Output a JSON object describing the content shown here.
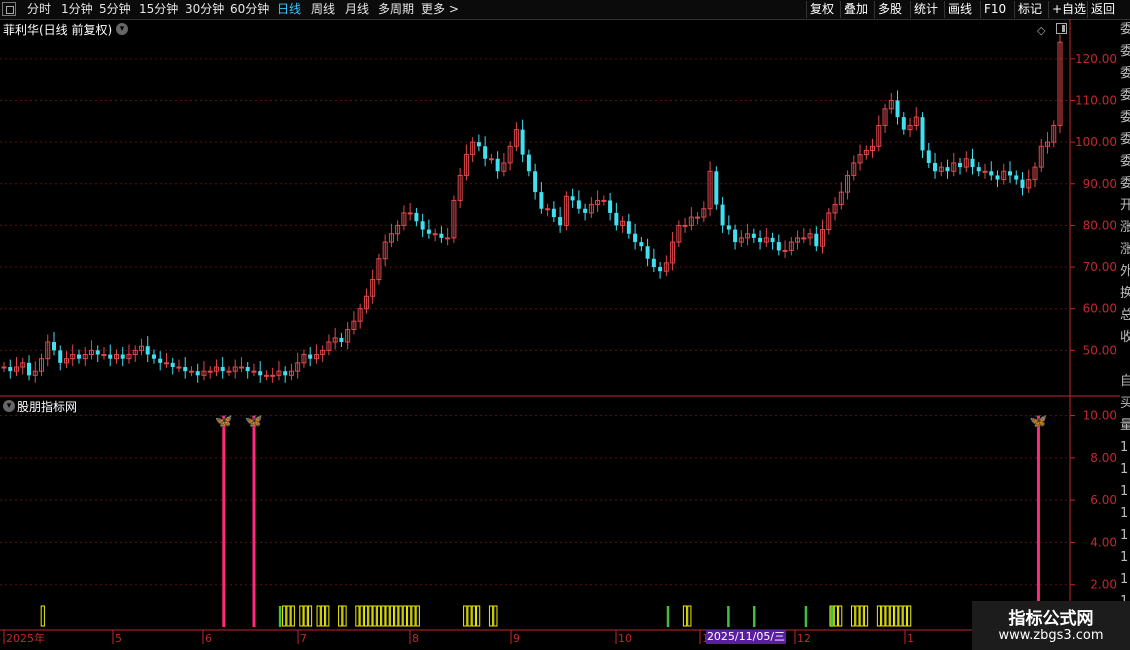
{
  "toolbar": {
    "left_items": [
      "分时",
      "1分钟",
      "5分钟",
      "15分钟",
      "30分钟",
      "60分钟",
      "日线",
      "周线",
      "月线",
      "多周期",
      "更多 >"
    ],
    "active_index": 6,
    "right_items": [
      "复权",
      "叠加",
      "多股",
      "统计",
      "画线",
      "F10",
      "标记",
      "+自选",
      "返回"
    ]
  },
  "stock_title": "菲利华(日线 前复权)",
  "indicator_title": "股朋指标网",
  "right_column_chars": [
    "委",
    "委",
    "委",
    "委",
    "委",
    "委",
    "委",
    "委",
    "开",
    "涨",
    "涨",
    "外",
    "换",
    "总",
    "收",
    "",
    "自",
    "买",
    "量",
    "1",
    "1",
    "1",
    "1",
    "1",
    "1",
    "1",
    "1"
  ],
  "watermark": {
    "title": "指标公式网",
    "url": "www.zbgs3.com"
  },
  "date_tag": "2025/11/05/三",
  "colors": {
    "up": "#e0484c",
    "down": "#40e0f0",
    "grid": "#5a1212",
    "axis": "#c0282c",
    "signal": "#ff2a7a",
    "box": "#f0f000",
    "bar_green": "#40c040"
  },
  "chart_data": [
    {
      "type": "candlestick",
      "title": "菲利华(日线 前复权)",
      "ylim": [
        40,
        125
      ],
      "y_ticks": [
        "120.00",
        "110.00",
        "100.00",
        "90.00",
        "80.00",
        "70.00",
        "60.00",
        "50.00"
      ],
      "x_labels": [
        "2025年",
        "5",
        "6",
        "7",
        "8",
        "9",
        "10",
        "11",
        "12",
        "1"
      ],
      "approx_close_series": [
        46,
        45,
        46,
        47,
        44,
        45,
        48,
        52,
        50,
        47,
        48,
        49,
        48,
        49,
        50,
        49,
        49,
        48,
        49,
        48,
        49,
        50,
        51,
        49,
        48,
        47,
        47,
        46,
        46,
        45,
        45,
        44,
        45,
        45,
        46,
        45,
        45,
        46,
        46,
        45,
        45,
        44,
        44,
        44,
        45,
        44,
        45,
        47,
        49,
        48,
        49,
        50,
        52,
        53,
        52,
        55,
        57,
        60,
        63,
        67,
        72,
        76,
        78,
        80,
        83,
        83,
        81,
        79,
        78,
        78,
        77,
        77,
        86,
        92,
        97,
        100,
        99,
        96,
        96,
        93,
        95,
        99,
        103,
        97,
        93,
        88,
        84,
        84,
        82,
        80,
        87,
        86,
        84,
        83,
        85,
        86,
        86,
        83,
        80,
        81,
        78,
        76,
        75,
        72,
        70,
        69,
        71,
        76,
        80,
        80,
        82,
        82,
        84,
        93,
        85,
        80,
        79,
        76,
        77,
        78,
        77,
        76,
        77,
        76,
        74,
        74,
        76,
        77,
        77,
        78,
        75,
        79,
        83,
        85,
        88,
        92,
        95,
        97,
        98,
        99,
        104,
        108,
        110,
        106,
        103,
        104,
        106,
        98,
        95,
        93,
        94,
        93,
        95,
        94,
        96,
        94,
        93,
        93,
        92,
        91,
        93,
        92,
        91,
        89,
        91,
        94,
        99,
        100,
        104,
        124
      ]
    },
    {
      "type": "indicator",
      "title": "股朋指标网",
      "ylim": [
        0,
        10.5
      ],
      "y_ticks": [
        "10.00",
        "8.00",
        "6.00",
        "4.00",
        "2.00"
      ],
      "signal_markers": [
        {
          "x_index": 51,
          "value": 10
        },
        {
          "x_index": 58,
          "value": 10
        },
        {
          "x_index": 240,
          "value": 10
        }
      ],
      "box_groups": [
        [
          9,
          9
        ],
        [
          65,
          67
        ],
        [
          69,
          71
        ],
        [
          73,
          75
        ],
        [
          78,
          79
        ],
        [
          82,
          96
        ],
        [
          107,
          110
        ],
        [
          113,
          114
        ],
        [
          158,
          159
        ],
        [
          192,
          194
        ],
        [
          197,
          200
        ],
        [
          203,
          210
        ]
      ],
      "green_bars": [
        58,
        64,
        154,
        168,
        174,
        186,
        192
      ]
    }
  ]
}
